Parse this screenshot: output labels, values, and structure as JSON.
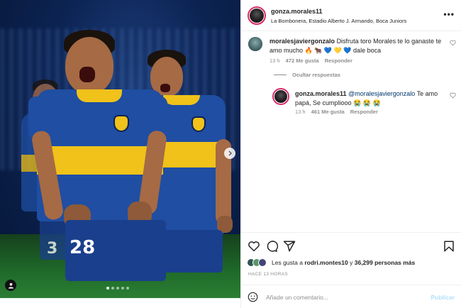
{
  "post": {
    "username": "gonza.morales11",
    "location": "La Bombonera, Estadio Alberto J. Armando, Boca Juniors",
    "more_icon": "more-horizontal-icon",
    "image": {
      "alt_player_number": "28"
    }
  },
  "comments": [
    {
      "username": "moralesjaviergonzalo",
      "text": "Disfruta toro Morales te lo ganaste te amo mucho 🔥 🐂 💙 💛 💙 dale boca",
      "time": "13 h",
      "likes": "472 Me gusta",
      "reply_label": "Responder"
    }
  ],
  "hide_replies_label": "Ocultar respuestas",
  "replies": [
    {
      "username": "gonza.morales11",
      "mention": "@moralesjaviergonzalo",
      "text": "Te amo papá, Se cumpliooo 😭 😭 😭",
      "time": "13 h",
      "likes": "461 Me gusta",
      "reply_label": "Responder"
    }
  ],
  "liked_by": {
    "prefix": "Les gusta a",
    "user": "rodri.montes10",
    "connector": "y",
    "count": "36,299 personas más"
  },
  "time_ago": "HACE 13 HORAS",
  "composer": {
    "placeholder": "Añade un comentario...",
    "post_label": "Publicar"
  },
  "colors": {
    "boca_blue": "#1f4ea3",
    "boca_yellow": "#f0c21a",
    "link": "#00376b",
    "muted": "#8e8e8e",
    "publish_disabled": "#b2dffc"
  }
}
